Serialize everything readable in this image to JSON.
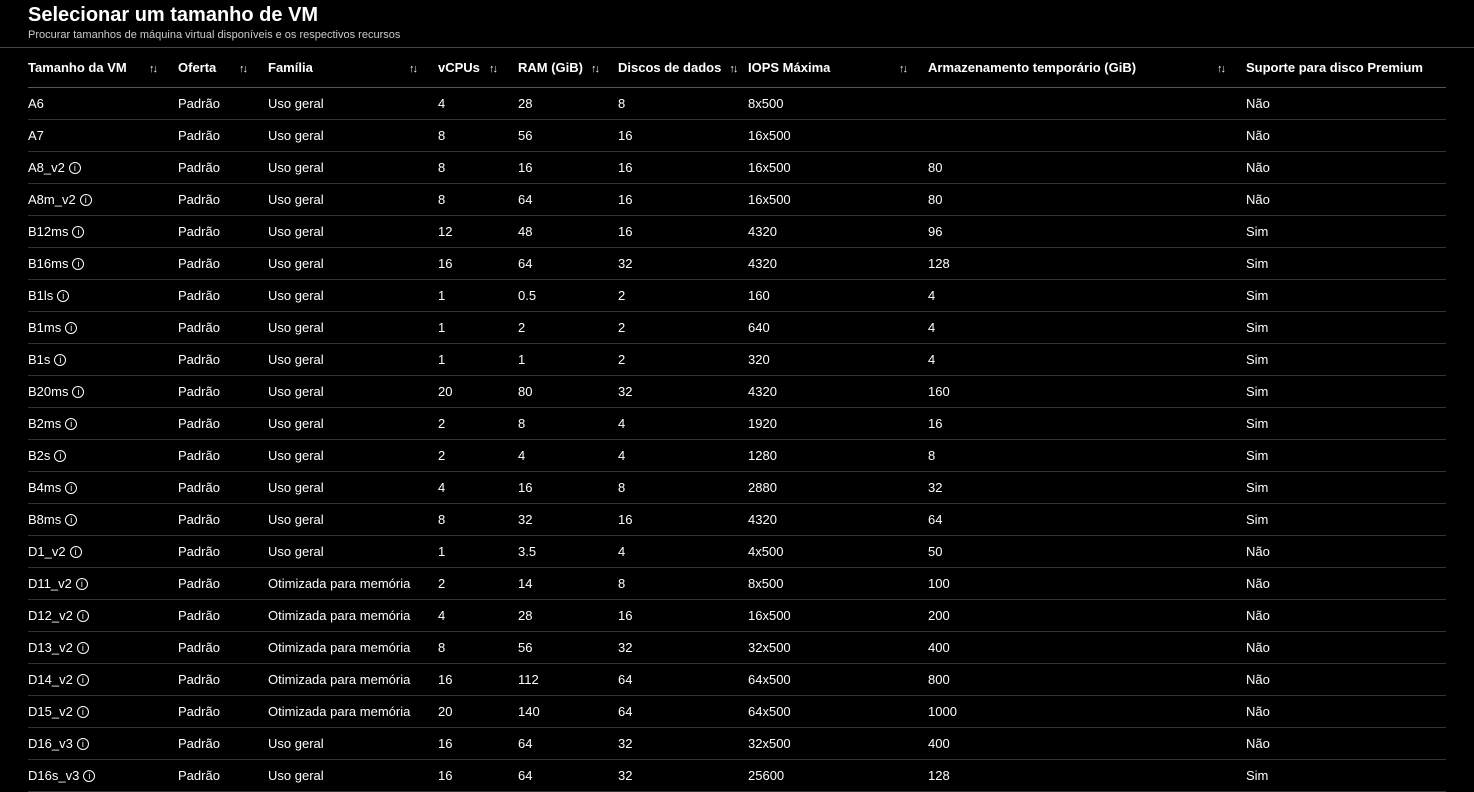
{
  "header": {
    "title": "Selecionar um tamanho de VM",
    "subtitle": "Procurar tamanhos de máquina virtual disponíveis e os respectivos recursos"
  },
  "columns": {
    "size": "Tamanho da VM",
    "offer": "Oferta",
    "family": "Família",
    "vcpu": "vCPUs",
    "ram": "RAM (GiB)",
    "disks": "Discos de dados",
    "iops": "IOPS Máxima",
    "temp": "Armazenamento temporário (GiB)",
    "premium": "Suporte para disco Premium"
  },
  "rows": [
    {
      "size": "A6",
      "info": false,
      "offer": "Padrão",
      "family": "Uso geral",
      "vcpu": "4",
      "ram": "28",
      "disks": "8",
      "iops": "8x500",
      "temp": "",
      "premium": "Não"
    },
    {
      "size": "A7",
      "info": false,
      "offer": "Padrão",
      "family": "Uso geral",
      "vcpu": "8",
      "ram": "56",
      "disks": "16",
      "iops": "16x500",
      "temp": "",
      "premium": "Não"
    },
    {
      "size": "A8_v2",
      "info": true,
      "offer": "Padrão",
      "family": "Uso geral",
      "vcpu": "8",
      "ram": "16",
      "disks": "16",
      "iops": "16x500",
      "temp": "80",
      "premium": "Não"
    },
    {
      "size": "A8m_v2",
      "info": true,
      "offer": "Padrão",
      "family": "Uso geral",
      "vcpu": "8",
      "ram": "64",
      "disks": "16",
      "iops": "16x500",
      "temp": "80",
      "premium": "Não"
    },
    {
      "size": "B12ms",
      "info": true,
      "offer": "Padrão",
      "family": "Uso geral",
      "vcpu": "12",
      "ram": "48",
      "disks": "16",
      "iops": "4320",
      "temp": "96",
      "premium": "Sim"
    },
    {
      "size": "B16ms",
      "info": true,
      "offer": "Padrão",
      "family": "Uso geral",
      "vcpu": "16",
      "ram": "64",
      "disks": "32",
      "iops": "4320",
      "temp": "128",
      "premium": "Sim"
    },
    {
      "size": "B1ls",
      "info": true,
      "offer": "Padrão",
      "family": "Uso geral",
      "vcpu": "1",
      "ram": "0.5",
      "disks": "2",
      "iops": "160",
      "temp": "4",
      "premium": "Sim"
    },
    {
      "size": "B1ms",
      "info": true,
      "offer": "Padrão",
      "family": "Uso geral",
      "vcpu": "1",
      "ram": "2",
      "disks": "2",
      "iops": "640",
      "temp": "4",
      "premium": "Sim"
    },
    {
      "size": "B1s",
      "info": true,
      "offer": "Padrão",
      "family": "Uso geral",
      "vcpu": "1",
      "ram": "1",
      "disks": "2",
      "iops": "320",
      "temp": "4",
      "premium": "Sim"
    },
    {
      "size": "B20ms",
      "info": true,
      "offer": "Padrão",
      "family": "Uso geral",
      "vcpu": "20",
      "ram": "80",
      "disks": "32",
      "iops": "4320",
      "temp": "160",
      "premium": "Sim"
    },
    {
      "size": "B2ms",
      "info": true,
      "offer": "Padrão",
      "family": "Uso geral",
      "vcpu": "2",
      "ram": "8",
      "disks": "4",
      "iops": "1920",
      "temp": "16",
      "premium": "Sim"
    },
    {
      "size": "B2s",
      "info": true,
      "offer": "Padrão",
      "family": "Uso geral",
      "vcpu": "2",
      "ram": "4",
      "disks": "4",
      "iops": "1280",
      "temp": "8",
      "premium": "Sim"
    },
    {
      "size": "B4ms",
      "info": true,
      "offer": "Padrão",
      "family": "Uso geral",
      "vcpu": "4",
      "ram": "16",
      "disks": "8",
      "iops": "2880",
      "temp": "32",
      "premium": "Sim"
    },
    {
      "size": "B8ms",
      "info": true,
      "offer": "Padrão",
      "family": "Uso geral",
      "vcpu": "8",
      "ram": "32",
      "disks": "16",
      "iops": "4320",
      "temp": "64",
      "premium": "Sim"
    },
    {
      "size": "D1_v2",
      "info": true,
      "offer": "Padrão",
      "family": "Uso geral",
      "vcpu": "1",
      "ram": "3.5",
      "disks": "4",
      "iops": "4x500",
      "temp": "50",
      "premium": "Não"
    },
    {
      "size": "D11_v2",
      "info": true,
      "offer": "Padrão",
      "family": "Otimizada para memória",
      "vcpu": "2",
      "ram": "14",
      "disks": "8",
      "iops": "8x500",
      "temp": "100",
      "premium": "Não"
    },
    {
      "size": "D12_v2",
      "info": true,
      "offer": "Padrão",
      "family": "Otimizada para memória",
      "vcpu": "4",
      "ram": "28",
      "disks": "16",
      "iops": "16x500",
      "temp": "200",
      "premium": "Não"
    },
    {
      "size": "D13_v2",
      "info": true,
      "offer": "Padrão",
      "family": "Otimizada para memória",
      "vcpu": "8",
      "ram": "56",
      "disks": "32",
      "iops": "32x500",
      "temp": "400",
      "premium": "Não"
    },
    {
      "size": "D14_v2",
      "info": true,
      "offer": "Padrão",
      "family": "Otimizada para memória",
      "vcpu": "16",
      "ram": "112",
      "disks": "64",
      "iops": "64x500",
      "temp": "800",
      "premium": "Não"
    },
    {
      "size": "D15_v2",
      "info": true,
      "offer": "Padrão",
      "family": "Otimizada para memória",
      "vcpu": "20",
      "ram": "140",
      "disks": "64",
      "iops": "64x500",
      "temp": "1000",
      "premium": "Não"
    },
    {
      "size": "D16_v3",
      "info": true,
      "offer": "Padrão",
      "family": "Uso geral",
      "vcpu": "16",
      "ram": "64",
      "disks": "32",
      "iops": "32x500",
      "temp": "400",
      "premium": "Não"
    },
    {
      "size": "D16s_v3",
      "info": true,
      "offer": "Padrão",
      "family": "Uso geral",
      "vcpu": "16",
      "ram": "64",
      "disks": "32",
      "iops": "25600",
      "temp": "128",
      "premium": "Sim"
    }
  ]
}
